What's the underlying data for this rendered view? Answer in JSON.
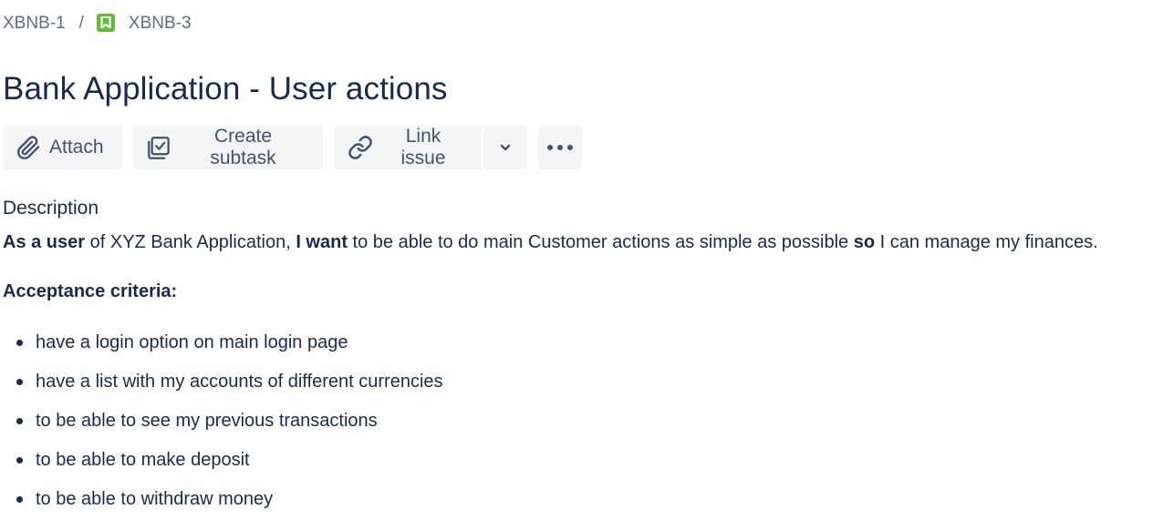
{
  "breadcrumb": {
    "parent": "XBNB-1",
    "separator": "/",
    "current": "XBNB-3",
    "current_icon": "story-bookmark-icon",
    "icon_color": "#63ba3c"
  },
  "issue": {
    "title": "Bank Application - User actions"
  },
  "toolbar": {
    "attach_label": "Attach",
    "attach_icon": "paperclip-icon",
    "create_subtask_label": "Create subtask",
    "create_subtask_icon": "subtask-icon",
    "link_issue_label": "Link issue",
    "link_issue_icon": "link-icon",
    "link_dropdown_icon": "chevron-down-icon",
    "more_icon": "more-dots-icon"
  },
  "description": {
    "heading": "Description",
    "story": {
      "part1_bold": "As a user",
      "part2": " of XYZ Bank Application, ",
      "part3_bold": "I want",
      "part4": " to be able to do main Customer actions as simple as possible ",
      "part5_bold": "so",
      "part6": " I can manage my finances."
    },
    "acceptance_heading": "Acceptance criteria:",
    "criteria": [
      "have a login option on main login page",
      "have a list with my accounts of different currencies",
      "to be able to see my previous transactions",
      "to be able to make deposit",
      "to be able to withdraw money"
    ]
  },
  "colors": {
    "text_primary": "#172b4d",
    "text_secondary": "#5e6c84",
    "button_bg": "#f4f5f7",
    "button_text": "#42526e"
  }
}
